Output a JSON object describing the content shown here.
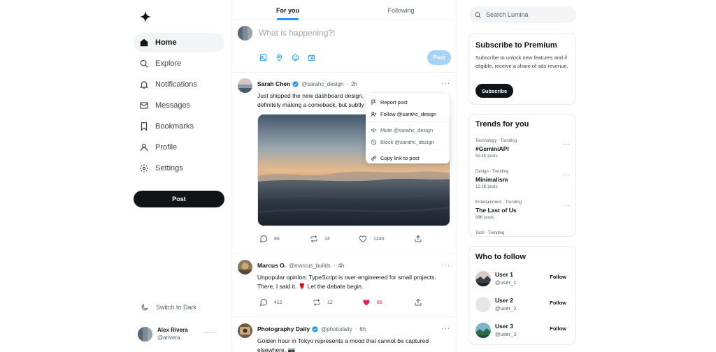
{
  "app": {
    "logo_icon": "sparkle-icon"
  },
  "sidebar": {
    "items": [
      {
        "label": "Home",
        "icon": "home-icon",
        "active": true
      },
      {
        "label": "Explore",
        "icon": "search-icon"
      },
      {
        "label": "Notifications",
        "icon": "bell-icon"
      },
      {
        "label": "Messages",
        "icon": "mail-icon"
      },
      {
        "label": "Bookmarks",
        "icon": "bookmark-icon"
      },
      {
        "label": "Profile",
        "icon": "user-icon"
      },
      {
        "label": "Settings",
        "icon": "gear-icon"
      }
    ],
    "post_label": "Post",
    "theme_label": "Switch to Dark",
    "user": {
      "name": "Alex Rivera",
      "handle": "@arivera"
    }
  },
  "feed": {
    "tabs": [
      {
        "label": "For you",
        "active": true
      },
      {
        "label": "Following"
      }
    ],
    "composer": {
      "placeholder": "What is happening?!",
      "post_label": "Post"
    },
    "posts": [
      {
        "author": "Sarah Chen",
        "verified": true,
        "handle": "@sarahc_design",
        "time": "2h",
        "text": "Just shipped the new dashboard design.\ndefinitely making a comeback, but subtly",
        "replies": "86",
        "reposts": "24",
        "likes": "1240",
        "liked": false
      },
      {
        "author": "Marcus O.",
        "verified": false,
        "handle": "@marcus_builds",
        "time": "4h",
        "text": "Unpopular opinion: TypeScript is over-engineered for small projects.\nThere, I said it. 🌹 Let the debate begin.",
        "replies": "412",
        "reposts": "12",
        "likes": "89",
        "liked": true
      },
      {
        "author": "Photography Daily",
        "verified": true,
        "handle": "@photodaily",
        "time": "6h",
        "text": "Golden hour in Tokyo represents a mood that cannot be captured\nelsewhere. 📷"
      }
    ]
  },
  "post_menu": {
    "items": [
      {
        "label": "Report post",
        "icon": "flag-icon"
      },
      {
        "label": "Follow @sarahc_design",
        "icon": "user-plus-icon"
      },
      {
        "label": "Mute @sarahc_design",
        "icon": "mute-icon"
      },
      {
        "label": "Block @sarahc_design",
        "icon": "block-icon"
      },
      {
        "label": "Copy link to post",
        "icon": "link-icon"
      }
    ]
  },
  "right": {
    "search_placeholder": "Search Lumina",
    "premium": {
      "title": "Subscribe to Premium",
      "description": "Subscribe to unlock new features and if eligible, receive a share of ads revenue.",
      "button": "Subscribe"
    },
    "trends": {
      "title": "Trends for you",
      "items": [
        {
          "category": "Technology · Trending",
          "topic": "#GeminiAPI",
          "posts": "52.4K posts"
        },
        {
          "category": "Design · Trending",
          "topic": "Minimalism",
          "posts": "12.1K posts"
        },
        {
          "category": "Entertainment · Trending",
          "topic": "The Last of Us",
          "posts": "89K posts"
        },
        {
          "category": "Tech · Trending",
          "topic": "",
          "posts": ""
        }
      ]
    },
    "who_to_follow": {
      "title": "Who to follow",
      "users": [
        {
          "name": "User 1",
          "handle": "@user_1",
          "button": "Follow"
        },
        {
          "name": "User 2",
          "handle": "@user_2",
          "button": "Follow"
        },
        {
          "name": "User 3",
          "handle": "@user_3",
          "button": "Follow"
        }
      ]
    }
  },
  "colors": {
    "accent": "#1d9bf0",
    "like": "#e0245e",
    "dark": "#0f1419",
    "muted": "#536471"
  }
}
